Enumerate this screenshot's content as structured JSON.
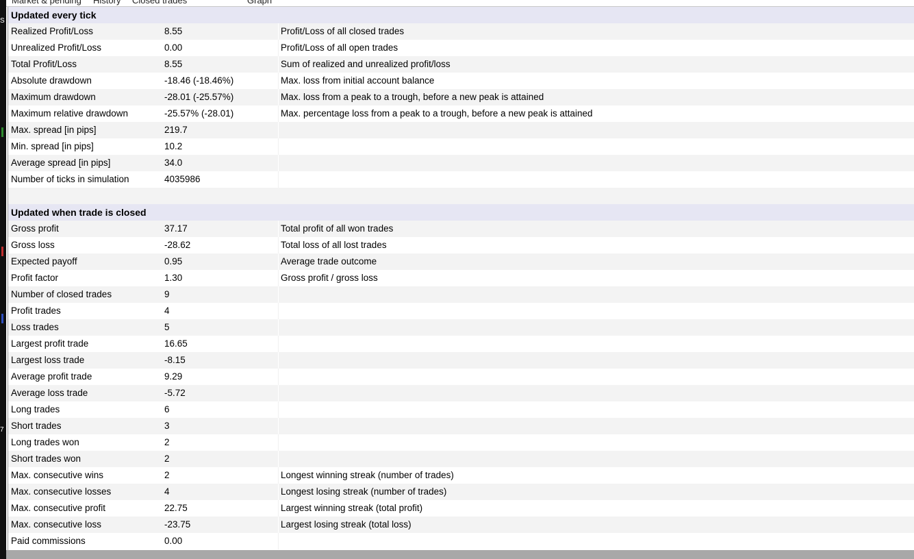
{
  "tabs": [
    "Market & pending",
    "History",
    "Closed trades",
    "",
    "Graph"
  ],
  "left_strip_marks": [
    "S",
    "7"
  ],
  "sections": [
    {
      "title": "Updated every tick",
      "rows": [
        {
          "name": "Realized Profit/Loss",
          "value": "8.55",
          "desc": "Profit/Loss of all closed trades"
        },
        {
          "name": "Unrealized Profit/Loss",
          "value": "0.00",
          "desc": "Profit/Loss of all open trades"
        },
        {
          "name": "Total Profit/Loss",
          "value": "8.55",
          "desc": "Sum of realized and unrealized profit/loss"
        },
        {
          "name": "Absolute drawdown",
          "value": "-18.46 (-18.46%)",
          "desc": "Max. loss from initial account balance"
        },
        {
          "name": "Maximum drawdown",
          "value": "-28.01 (-25.57%)",
          "desc": "Max. loss from a peak to a trough, before a new peak is attained"
        },
        {
          "name": "Maximum relative drawdown",
          "value": "-25.57% (-28.01)",
          "desc": "Max. percentage loss from a peak to a trough, before a new peak is attained"
        },
        {
          "name": "Max. spread [in pips]",
          "value": "219.7",
          "desc": ""
        },
        {
          "name": "Min. spread [in pips]",
          "value": "10.2",
          "desc": ""
        },
        {
          "name": "Average spread [in pips]",
          "value": "34.0",
          "desc": ""
        },
        {
          "name": "Number of ticks in simulation",
          "value": "4035986",
          "desc": ""
        }
      ]
    },
    {
      "title": "Updated when trade is closed",
      "rows": [
        {
          "name": "Gross profit",
          "value": "37.17",
          "desc": "Total profit of all won trades"
        },
        {
          "name": "Gross loss",
          "value": "-28.62",
          "desc": "Total loss of all lost trades"
        },
        {
          "name": "Expected payoff",
          "value": "0.95",
          "desc": "Average trade outcome"
        },
        {
          "name": "Profit factor",
          "value": "1.30",
          "desc": "Gross profit / gross loss"
        },
        {
          "name": "Number of closed trades",
          "value": "9",
          "desc": ""
        },
        {
          "name": "Profit trades",
          "value": "4",
          "desc": ""
        },
        {
          "name": "Loss trades",
          "value": "5",
          "desc": ""
        },
        {
          "name": "Largest profit trade",
          "value": "16.65",
          "desc": ""
        },
        {
          "name": "Largest loss trade",
          "value": "-8.15",
          "desc": ""
        },
        {
          "name": "Average profit trade",
          "value": "9.29",
          "desc": ""
        },
        {
          "name": "Average loss trade",
          "value": "-5.72",
          "desc": ""
        },
        {
          "name": "Long trades",
          "value": "6",
          "desc": ""
        },
        {
          "name": "Short trades",
          "value": "3",
          "desc": ""
        },
        {
          "name": "Long trades won",
          "value": "2",
          "desc": ""
        },
        {
          "name": "Short trades won",
          "value": "2",
          "desc": ""
        },
        {
          "name": "Max. consecutive wins",
          "value": "2",
          "desc": "Longest winning streak (number of trades)"
        },
        {
          "name": "Max. consecutive losses",
          "value": "4",
          "desc": "Longest losing streak (number of trades)"
        },
        {
          "name": "Max. consecutive profit",
          "value": "22.75",
          "desc": "Largest winning streak (total profit)"
        },
        {
          "name": "Max. consecutive loss",
          "value": "-23.75",
          "desc": "Largest losing streak (total loss)"
        },
        {
          "name": "Paid commissions",
          "value": "0.00",
          "desc": ""
        }
      ]
    }
  ]
}
